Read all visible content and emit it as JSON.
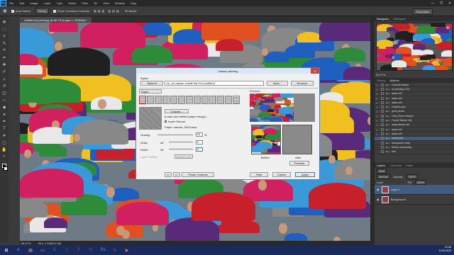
{
  "menubar": {
    "items": [
      "File",
      "Edit",
      "Image",
      "Layer",
      "Type",
      "Select",
      "Filter",
      "3D",
      "View",
      "Window",
      "Help"
    ]
  },
  "window_controls": [
    "—",
    "❐",
    "✕"
  ],
  "options_bar": {
    "auto_select": "Auto-Select:",
    "auto_select_value": "Group",
    "show_transform": "Show Transform Controls",
    "mode_3d": "3D Mode:"
  },
  "workspace": "Essentials",
  "doc_tab": "Untitled-oil-paint.jpg @ 66.7% (Layer 1, RGB/8#) *",
  "status_bar": {
    "zoom": "66.67%",
    "doc": "Doc: 1.24M/11.9M"
  },
  "navigator": {
    "tabs": [
      "Navigator",
      "Histogram"
    ],
    "zoom": "66.67%"
  },
  "actions": {
    "tabs": [
      "History",
      "Actions"
    ],
    "rows": [
      {
        "label": "Default Actions",
        "checked": true
      },
      {
        "label": "oil painting CS4",
        "checked": true
      },
      {
        "label": "aaaa mill",
        "checked": true
      },
      {
        "label": "aaaa mill",
        "checked": true
      },
      {
        "label": "aaaa mill",
        "checked": true
      },
      {
        "label": "Graphic pen",
        "checked": true
      },
      {
        "label": "glow pencil",
        "checked": true
      },
      {
        "label": "Grey Pencil Sketch",
        "checked": true
      },
      {
        "label": "Pencil Sketch HQ",
        "checked": true
      },
      {
        "label": "aaaa family cds",
        "checked": true
      },
      {
        "label": "aaaa mill",
        "checked": true
      },
      {
        "label": "aaaa mill",
        "checked": true
      },
      {
        "label": "watercolor",
        "checked": false
      },
      {
        "label": "transparent strip",
        "checked": false
      },
      {
        "label": "family oil painting",
        "checked": false
      },
      {
        "label": "hhh",
        "checked": false
      }
    ],
    "selected_index": 12
  },
  "layers": {
    "tabs": [
      "Layers",
      "Channels",
      "Paths"
    ],
    "kind": "Kind",
    "blend": "Normal",
    "opacity_label": "Opacity:",
    "opacity": "100%",
    "lock_label": "Lock:",
    "fill_label": "Fill:",
    "fill": "100%",
    "items": [
      {
        "name": "Layer 1",
        "selected": true
      },
      {
        "name": "Background",
        "selected": false
      }
    ]
  },
  "dialog": {
    "title": "Classic painting",
    "styles_label": "Styles",
    "styles_dropdown": "Styles ▾",
    "style_name": "mr_oil classic: bristle flat 09 (modified)",
    "save": "Save...",
    "remove": "Remove",
    "paper_dropdown": "Paper",
    "custom": "Custom...",
    "custom_note": "(Load user-defined paper image.)",
    "invert_texture": "Invert Texture",
    "paper_name": "Paper: canvas_0004.bmp",
    "scaling_label": "Scaling",
    "scaling_value": "25",
    "scaling_unit": "%",
    "grain_label": "Grain",
    "grain_off": "off",
    "grain_value": "0",
    "relief_label": "Relief",
    "relief_off": "off",
    "relief_value": "0",
    "light_position": "Light Position",
    "light_value": "Bottom Left",
    "preview_label": "Preview",
    "before": "Before",
    "after": "After",
    "preview_btn": "Preview",
    "nav_prev": "<<",
    "nav_next": ">>",
    "power_controls": "Power Controls",
    "help": "Help",
    "cancel": "Cancel",
    "apply": "Apply"
  },
  "taskbar": {
    "icons": [
      "start-icon",
      "ie-icon",
      "explorer-icon",
      "folder-icon",
      "camtasia-icon",
      "excel-icon",
      "powerpoint-icon",
      "word-icon",
      "photoshop-icon",
      "paint-icon",
      "media-icon"
    ],
    "time": "21:45",
    "date": "11.09.2015"
  }
}
